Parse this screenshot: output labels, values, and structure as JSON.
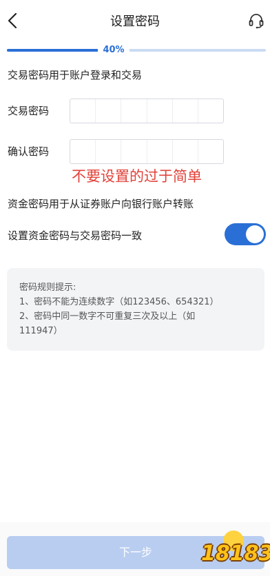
{
  "header": {
    "title": "设置密码",
    "back_icon": "chevron-left-icon",
    "support_icon": "headset-icon"
  },
  "progress": {
    "label": "40%",
    "value": 0.4
  },
  "trade_section": {
    "description": "交易密码用于账户登录和交易",
    "password_label": "交易密码",
    "confirm_label": "确认密码"
  },
  "annotation": "不要设置的过于简单",
  "fund_section": {
    "description": "资金密码用于从证券账户向银行账户转账",
    "same_as_trade_label": "设置资金密码与交易密码一致",
    "same_as_trade_enabled": true
  },
  "rules": {
    "title": "密码规则提示:",
    "lines": [
      "1、密码不能为连续数字（如123456、654321）",
      "2、密码中同一数字不可重复三次及以上（如",
      "111947）"
    ]
  },
  "footer": {
    "next_label": "下一步"
  },
  "watermark": "18183",
  "colors": {
    "accent": "#2a6fd6",
    "annotation": "#e2413a",
    "button_disabled": "#b9cdf0"
  }
}
